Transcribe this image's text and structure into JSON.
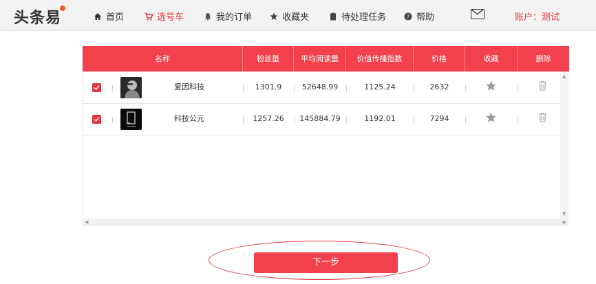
{
  "header": {
    "logo": "头条易",
    "nav": [
      {
        "label": "首页",
        "icon": "home-icon",
        "active": false
      },
      {
        "label": "选号车",
        "icon": "cart-icon",
        "active": true
      },
      {
        "label": "我的订单",
        "icon": "bell-icon",
        "active": false
      },
      {
        "label": "收藏夹",
        "icon": "star-icon",
        "active": false
      },
      {
        "label": "待处理任务",
        "icon": "clipboard-icon",
        "active": false
      },
      {
        "label": "帮助",
        "icon": "help-icon",
        "active": false
      }
    ],
    "mail_icon": "mail-icon",
    "account": "账户：测试"
  },
  "table": {
    "columns": [
      "名称",
      "粉丝量",
      "平均阅读量",
      "价值传播指数",
      "价格",
      "收藏",
      "删除"
    ],
    "rows": [
      {
        "checked": true,
        "name": "爱因科技",
        "fans": "1301.9",
        "avg_read": "52648.99",
        "value_index": "1125.24",
        "price": "2632"
      },
      {
        "checked": true,
        "name": "科技公元",
        "fans": "1257.26",
        "avg_read": "145884.79",
        "value_index": "1192.01",
        "price": "7294"
      }
    ]
  },
  "next_button": "下一步",
  "colors": {
    "accent": "#f2404c",
    "active_nav": "#e5323b"
  }
}
